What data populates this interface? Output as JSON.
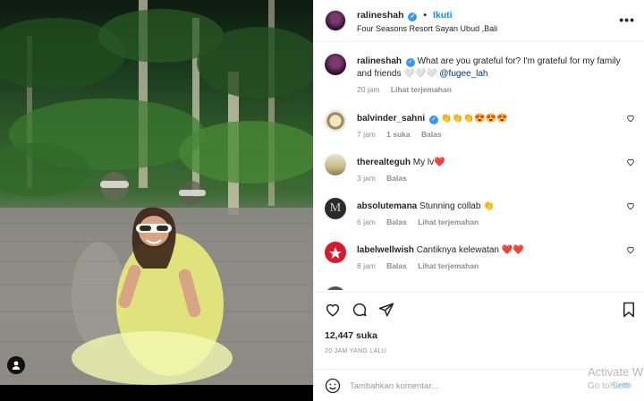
{
  "header": {
    "username": "ralineshah",
    "separator": "•",
    "follow_label": "Ikuti",
    "location": "Four Seasons Resort Sayan Ubud ,Bali",
    "more_label": "•••"
  },
  "caption": {
    "username": "ralineshah",
    "text": "What are you grateful for? I'm grateful for my family and friends 🤍🤍🤍",
    "mention": "@fugee_lah",
    "time": "20 jam",
    "translate_label": "Lihat terjemahan"
  },
  "comments": [
    {
      "username": "balvinder_sahni",
      "verified": true,
      "text": "👏👏👏😍😍😍",
      "time": "7 jam",
      "likes": "1 suka",
      "reply": "Balas",
      "translate": ""
    },
    {
      "username": "therealteguh",
      "verified": false,
      "text": "My lv❤️",
      "time": "3 jam",
      "likes": "",
      "reply": "Balas",
      "translate": ""
    },
    {
      "username": "absolutemana",
      "verified": false,
      "text": "Stunning collab 👏",
      "time": "6 jam",
      "likes": "",
      "reply": "Balas",
      "translate": "Lihat terjemahan"
    },
    {
      "username": "labelwellwish",
      "verified": false,
      "text": "Cantiknya kelewatan ❤️❤️",
      "time": "8 jam",
      "likes": "",
      "reply": "Balas",
      "translate": "Lihat terjemahan"
    }
  ],
  "actions": {
    "likes_count": "12,447 suka",
    "posted_ago": "20 JAM YANG LALU"
  },
  "add_comment": {
    "placeholder": "Tambahkan komentar...",
    "post_label": "Kirim"
  },
  "watermark": {
    "line1": "Activate W",
    "line2": "Go to Setti"
  },
  "icons": [
    "verified-badge-icon",
    "more-options-icon",
    "heart-icon",
    "comment-icon",
    "share-icon",
    "bookmark-icon",
    "emoji-icon",
    "user-tag-icon"
  ],
  "colors": {
    "accent": "#0095f6",
    "verified": "#3897f0",
    "muted": "#8e8e8e"
  }
}
